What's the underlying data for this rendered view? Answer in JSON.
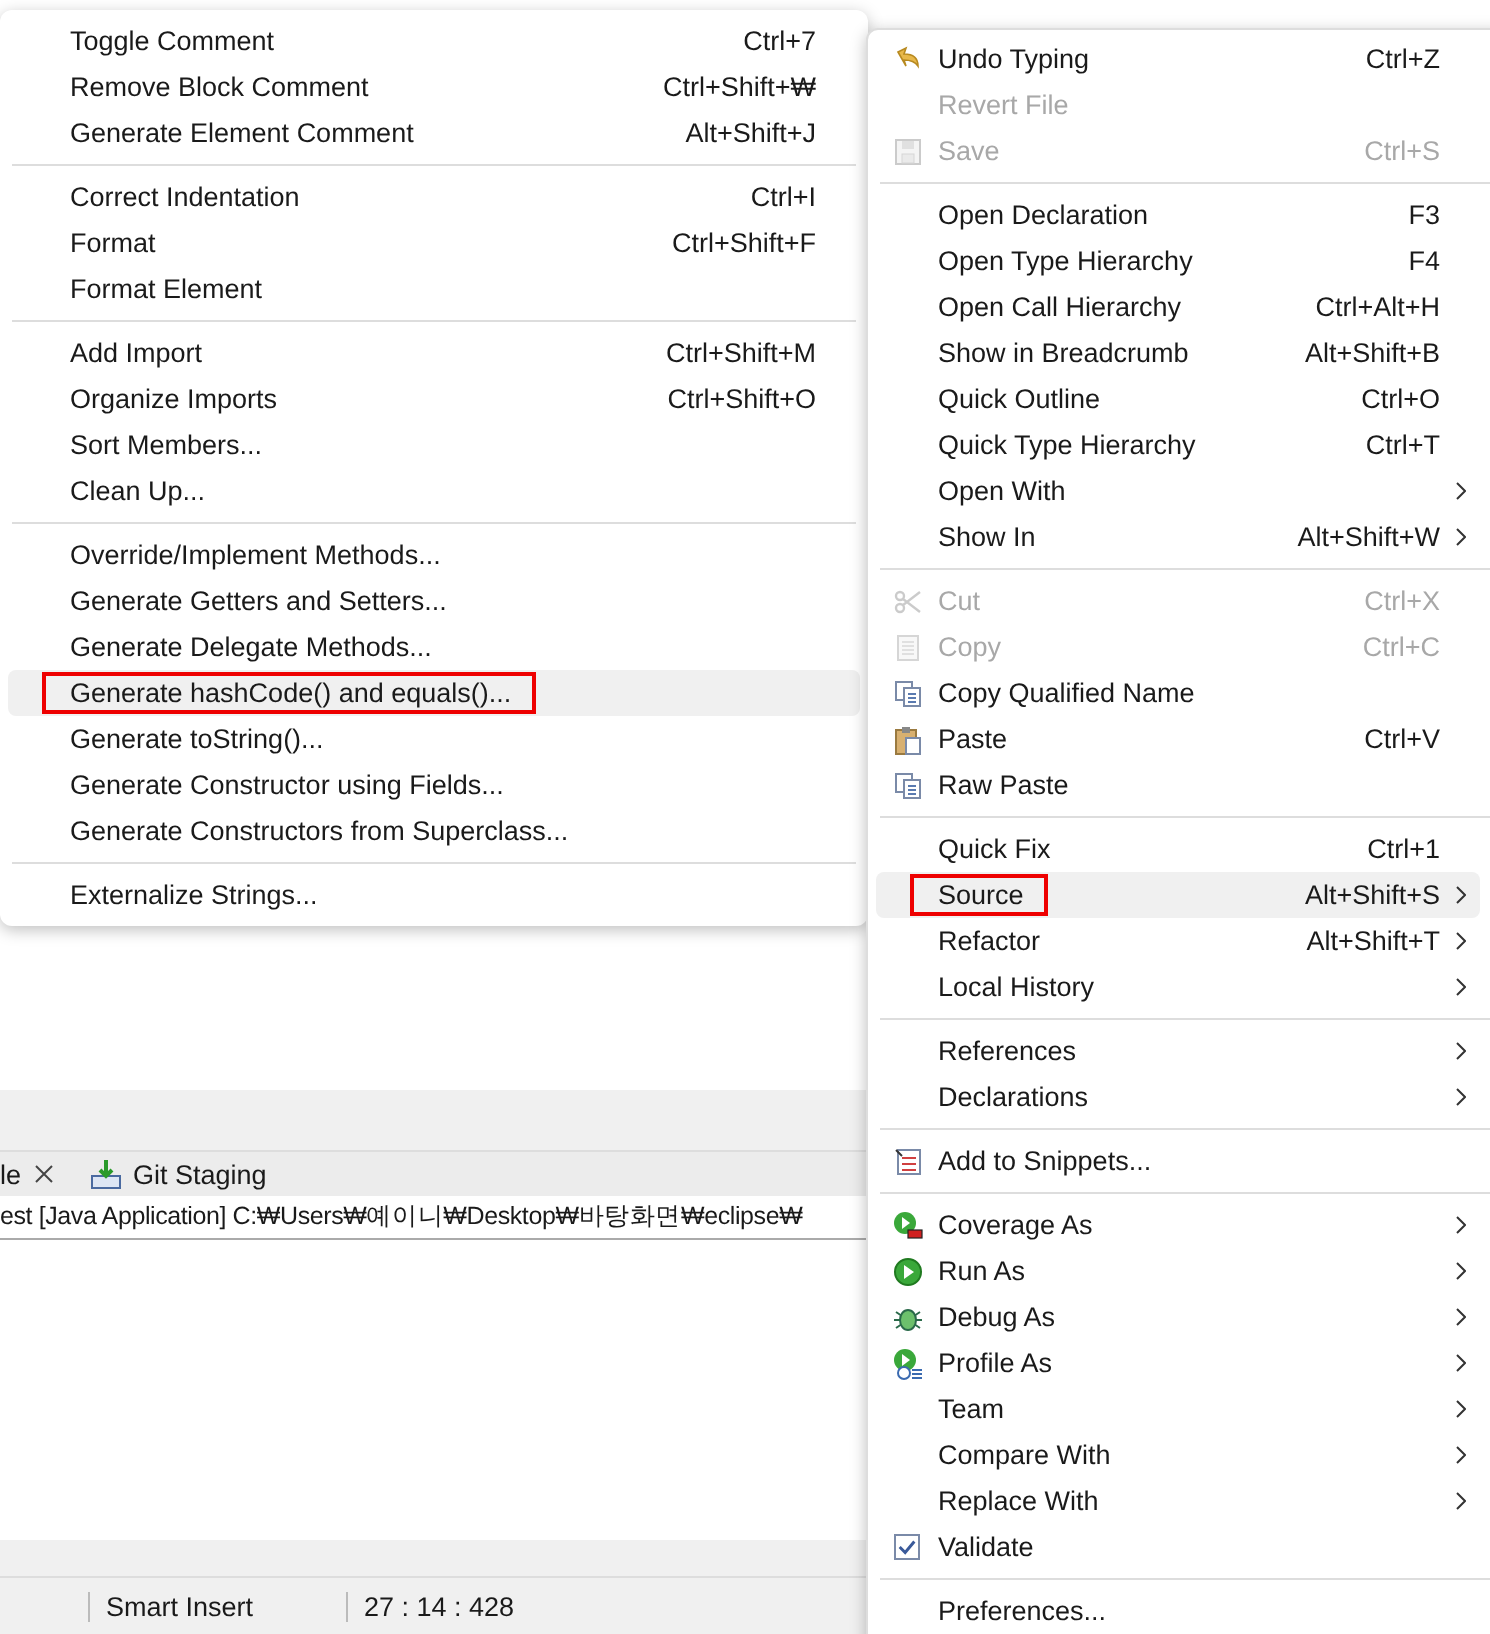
{
  "source_menu": {
    "items": [
      {
        "kind": "item",
        "label": "Toggle Comment",
        "shortcut": "Ctrl+7",
        "selected": false,
        "marked": false
      },
      {
        "kind": "item",
        "label": "Remove Block Comment",
        "shortcut": "Ctrl+Shift+₩",
        "selected": false,
        "marked": false
      },
      {
        "kind": "item",
        "label": "Generate Element Comment",
        "shortcut": "Alt+Shift+J",
        "selected": false,
        "marked": false
      },
      {
        "kind": "separator"
      },
      {
        "kind": "item",
        "label": "Correct Indentation",
        "shortcut": "Ctrl+I",
        "selected": false,
        "marked": false
      },
      {
        "kind": "item",
        "label": "Format",
        "shortcut": "Ctrl+Shift+F",
        "selected": false,
        "marked": false
      },
      {
        "kind": "item",
        "label": "Format Element",
        "selected": false,
        "marked": false
      },
      {
        "kind": "separator"
      },
      {
        "kind": "item",
        "label": "Add Import",
        "shortcut": "Ctrl+Shift+M",
        "selected": false,
        "marked": false
      },
      {
        "kind": "item",
        "label": "Organize Imports",
        "shortcut": "Ctrl+Shift+O",
        "selected": false,
        "marked": false
      },
      {
        "kind": "item",
        "label": "Sort Members...",
        "selected": false,
        "marked": false
      },
      {
        "kind": "item",
        "label": "Clean Up...",
        "selected": false,
        "marked": false
      },
      {
        "kind": "separator"
      },
      {
        "kind": "item",
        "label": "Override/Implement Methods...",
        "selected": false,
        "marked": false
      },
      {
        "kind": "item",
        "label": "Generate Getters and Setters...",
        "selected": false,
        "marked": false
      },
      {
        "kind": "item",
        "label": "Generate Delegate Methods...",
        "selected": false,
        "marked": false
      },
      {
        "kind": "item",
        "label": "Generate hashCode() and equals()...",
        "selected": true,
        "marked": true
      },
      {
        "kind": "item",
        "label": "Generate toString()...",
        "selected": false,
        "marked": false
      },
      {
        "kind": "item",
        "label": "Generate Constructor using Fields...",
        "selected": false,
        "marked": false
      },
      {
        "kind": "item",
        "label": "Generate Constructors from Superclass...",
        "selected": false,
        "marked": false
      },
      {
        "kind": "separator"
      },
      {
        "kind": "item",
        "label": "Externalize Strings...",
        "selected": false,
        "marked": false
      }
    ]
  },
  "context_menu": {
    "items": [
      {
        "kind": "item",
        "label": "Undo Typing",
        "shortcut": "Ctrl+Z",
        "submenu": false,
        "disabled": false,
        "selected": false,
        "marked": false
      },
      {
        "kind": "item",
        "label": "Revert File",
        "submenu": false,
        "disabled": true,
        "selected": false,
        "marked": false
      },
      {
        "kind": "item",
        "label": "Save",
        "shortcut": "Ctrl+S",
        "submenu": false,
        "disabled": true,
        "selected": false,
        "marked": false
      },
      {
        "kind": "separator"
      },
      {
        "kind": "item",
        "label": "Open Declaration",
        "shortcut": "F3",
        "submenu": false,
        "disabled": false,
        "selected": false,
        "marked": false
      },
      {
        "kind": "item",
        "label": "Open Type Hierarchy",
        "shortcut": "F4",
        "submenu": false,
        "disabled": false,
        "selected": false,
        "marked": false
      },
      {
        "kind": "item",
        "label": "Open Call Hierarchy",
        "shortcut": "Ctrl+Alt+H",
        "submenu": false,
        "disabled": false,
        "selected": false,
        "marked": false
      },
      {
        "kind": "item",
        "label": "Show in Breadcrumb",
        "shortcut": "Alt+Shift+B",
        "submenu": false,
        "disabled": false,
        "selected": false,
        "marked": false
      },
      {
        "kind": "item",
        "label": "Quick Outline",
        "shortcut": "Ctrl+O",
        "submenu": false,
        "disabled": false,
        "selected": false,
        "marked": false
      },
      {
        "kind": "item",
        "label": "Quick Type Hierarchy",
        "shortcut": "Ctrl+T",
        "submenu": false,
        "disabled": false,
        "selected": false,
        "marked": false
      },
      {
        "kind": "item",
        "label": "Open With",
        "submenu": true,
        "disabled": false,
        "selected": false,
        "marked": false
      },
      {
        "kind": "item",
        "label": "Show In",
        "shortcut": "Alt+Shift+W",
        "submenu": true,
        "disabled": false,
        "selected": false,
        "marked": false
      },
      {
        "kind": "separator"
      },
      {
        "kind": "item",
        "label": "Cut",
        "shortcut": "Ctrl+X",
        "submenu": false,
        "disabled": true,
        "selected": false,
        "marked": false
      },
      {
        "kind": "item",
        "label": "Copy",
        "shortcut": "Ctrl+C",
        "submenu": false,
        "disabled": true,
        "selected": false,
        "marked": false
      },
      {
        "kind": "item",
        "label": "Copy Qualified Name",
        "submenu": false,
        "disabled": false,
        "selected": false,
        "marked": false
      },
      {
        "kind": "item",
        "label": "Paste",
        "shortcut": "Ctrl+V",
        "submenu": false,
        "disabled": false,
        "selected": false,
        "marked": false
      },
      {
        "kind": "item",
        "label": "Raw Paste",
        "submenu": false,
        "disabled": false,
        "selected": false,
        "marked": false
      },
      {
        "kind": "separator"
      },
      {
        "kind": "item",
        "label": "Quick Fix",
        "shortcut": "Ctrl+1",
        "submenu": false,
        "disabled": false,
        "selected": false,
        "marked": false
      },
      {
        "kind": "item",
        "label": "Source",
        "shortcut": "Alt+Shift+S",
        "submenu": true,
        "disabled": false,
        "selected": true,
        "marked": true
      },
      {
        "kind": "item",
        "label": "Refactor",
        "shortcut": "Alt+Shift+T",
        "submenu": true,
        "disabled": false,
        "selected": false,
        "marked": false
      },
      {
        "kind": "item",
        "label": "Local History",
        "submenu": true,
        "disabled": false,
        "selected": false,
        "marked": false
      },
      {
        "kind": "separator"
      },
      {
        "kind": "item",
        "label": "References",
        "submenu": true,
        "disabled": false,
        "selected": false,
        "marked": false
      },
      {
        "kind": "item",
        "label": "Declarations",
        "submenu": true,
        "disabled": false,
        "selected": false,
        "marked": false
      },
      {
        "kind": "separator"
      },
      {
        "kind": "item",
        "label": "Add to Snippets...",
        "submenu": false,
        "disabled": false,
        "selected": false,
        "marked": false
      },
      {
        "kind": "separator"
      },
      {
        "kind": "item",
        "label": "Coverage As",
        "submenu": true,
        "disabled": false,
        "selected": false,
        "marked": false
      },
      {
        "kind": "item",
        "label": "Run As",
        "submenu": true,
        "disabled": false,
        "selected": false,
        "marked": false
      },
      {
        "kind": "item",
        "label": "Debug As",
        "submenu": true,
        "disabled": false,
        "selected": false,
        "marked": false
      },
      {
        "kind": "item",
        "label": "Profile As",
        "submenu": true,
        "disabled": false,
        "selected": false,
        "marked": false
      },
      {
        "kind": "item",
        "label": "Team",
        "submenu": true,
        "disabled": false,
        "selected": false,
        "marked": false
      },
      {
        "kind": "item",
        "label": "Compare With",
        "submenu": true,
        "disabled": false,
        "selected": false,
        "marked": false
      },
      {
        "kind": "item",
        "label": "Replace With",
        "submenu": true,
        "disabled": false,
        "selected": false,
        "marked": false
      },
      {
        "kind": "check",
        "label": "Validate",
        "checked": true,
        "submenu": false,
        "disabled": false,
        "selected": false,
        "marked": false
      },
      {
        "kind": "separator"
      },
      {
        "kind": "item",
        "label": "Preferences...",
        "submenu": false,
        "disabled": false,
        "selected": false,
        "marked": false
      }
    ]
  },
  "console": {
    "tabs": [
      {
        "label": "le",
        "closable": true
      },
      {
        "label": "Git Staging",
        "closable": false
      }
    ],
    "header": "est [Java Application] C:₩Users₩예이니₩Desktop₩바탕화면₩eclipse₩"
  },
  "status_bar": {
    "mode": "Smart Insert",
    "position": "27 : 14 : 428"
  }
}
